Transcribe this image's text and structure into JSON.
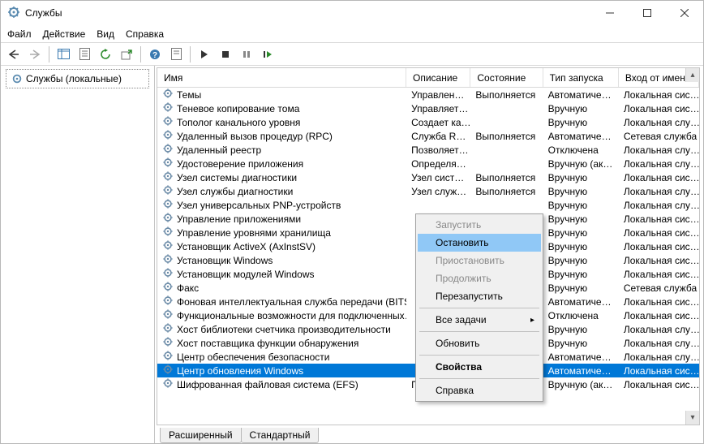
{
  "window": {
    "title": "Службы"
  },
  "menu": {
    "file": "Файл",
    "action": "Действие",
    "view": "Вид",
    "help": "Справка"
  },
  "left_panel": {
    "node_label": "Службы (локальные)"
  },
  "columns": {
    "name": "Имя",
    "description": "Описание",
    "state": "Состояние",
    "startup": "Тип запуска",
    "logon": "Вход от имени"
  },
  "rows": [
    {
      "name": "Темы",
      "desc": "Управлен…",
      "state": "Выполняется",
      "start": "Автоматиче…",
      "logon": "Локальная сис…"
    },
    {
      "name": "Теневое копирование тома",
      "desc": "Управляет…",
      "state": "",
      "start": "Вручную",
      "logon": "Локальная сис…"
    },
    {
      "name": "Тополог канального уровня",
      "desc": "Создает ка…",
      "state": "",
      "start": "Вручную",
      "logon": "Локальная слу…"
    },
    {
      "name": "Удаленный вызов процедур (RPC)",
      "desc": "Служба R…",
      "state": "Выполняется",
      "start": "Автоматиче…",
      "logon": "Сетевая служба"
    },
    {
      "name": "Удаленный реестр",
      "desc": "Позволяет…",
      "state": "",
      "start": "Отключена",
      "logon": "Локальная слу…"
    },
    {
      "name": "Удостоверение приложения",
      "desc": "Определя…",
      "state": "",
      "start": "Вручную (ак…",
      "logon": "Локальная слу…"
    },
    {
      "name": "Узел системы диагностики",
      "desc": "Узел сист…",
      "state": "Выполняется",
      "start": "Вручную",
      "logon": "Локальная сис…"
    },
    {
      "name": "Узел службы диагностики",
      "desc": "Узел служ…",
      "state": "Выполняется",
      "start": "Вручную",
      "logon": "Локальная слу…"
    },
    {
      "name": "Узел универсальных PNP-устройств",
      "desc": "",
      "state": "",
      "start": "Вручную",
      "logon": "Локальная слу…"
    },
    {
      "name": "Управление приложениями",
      "desc": "",
      "state": "",
      "start": "Вручную",
      "logon": "Локальная сис…"
    },
    {
      "name": "Управление уровнями хранилища",
      "desc": "",
      "state": "",
      "start": "Вручную",
      "logon": "Локальная сис…"
    },
    {
      "name": "Установщик ActiveX (AxInstSV)",
      "desc": "",
      "state": "",
      "start": "Вручную",
      "logon": "Локальная сис…"
    },
    {
      "name": "Установщик Windows",
      "desc": "",
      "state": "",
      "start": "Вручную",
      "logon": "Локальная сис…"
    },
    {
      "name": "Установщик модулей Windows",
      "desc": "",
      "state": "",
      "start": "Вручную",
      "logon": "Локальная сис…"
    },
    {
      "name": "Факс",
      "desc": "",
      "state": "",
      "start": "Вручную",
      "logon": "Сетевая служба"
    },
    {
      "name": "Фоновая интеллектуальная служба передачи (BITS)",
      "desc": "",
      "state": "",
      "start": "Автоматиче…",
      "logon": "Локальная сис…"
    },
    {
      "name": "Функциональные возможности для подключенных…",
      "desc": "",
      "state": "",
      "start": "Отключена",
      "logon": "Локальная сис…"
    },
    {
      "name": "Хост библиотеки счетчика производительности",
      "desc": "",
      "state": "",
      "start": "Вручную",
      "logon": "Локальная слу…"
    },
    {
      "name": "Хост поставщика функции обнаружения",
      "desc": "",
      "state": "",
      "start": "Вручную",
      "logon": "Локальная слу…"
    },
    {
      "name": "Центр обеспечения безопасности",
      "desc": "",
      "state": "",
      "start": "Автоматиче…",
      "logon": "Локальная слу…"
    },
    {
      "name": "Центр обновления Windows",
      "desc": "",
      "state": "",
      "start": "Автоматиче…",
      "logon": "Локальная сис…",
      "selected": true
    },
    {
      "name": "Шифрованная файловая система (EFS)",
      "desc": "Предост…",
      "state": "",
      "start": "Вручную (ак…",
      "logon": "Локальная сис…"
    }
  ],
  "context_menu": {
    "start": "Запустить",
    "stop": "Остановить",
    "pause": "Приостановить",
    "resume": "Продолжить",
    "restart": "Перезапустить",
    "all_tasks": "Все задачи",
    "refresh": "Обновить",
    "properties": "Свойства",
    "help": "Справка"
  },
  "footer_tabs": {
    "extended": "Расширенный",
    "standard": "Стандартный"
  }
}
